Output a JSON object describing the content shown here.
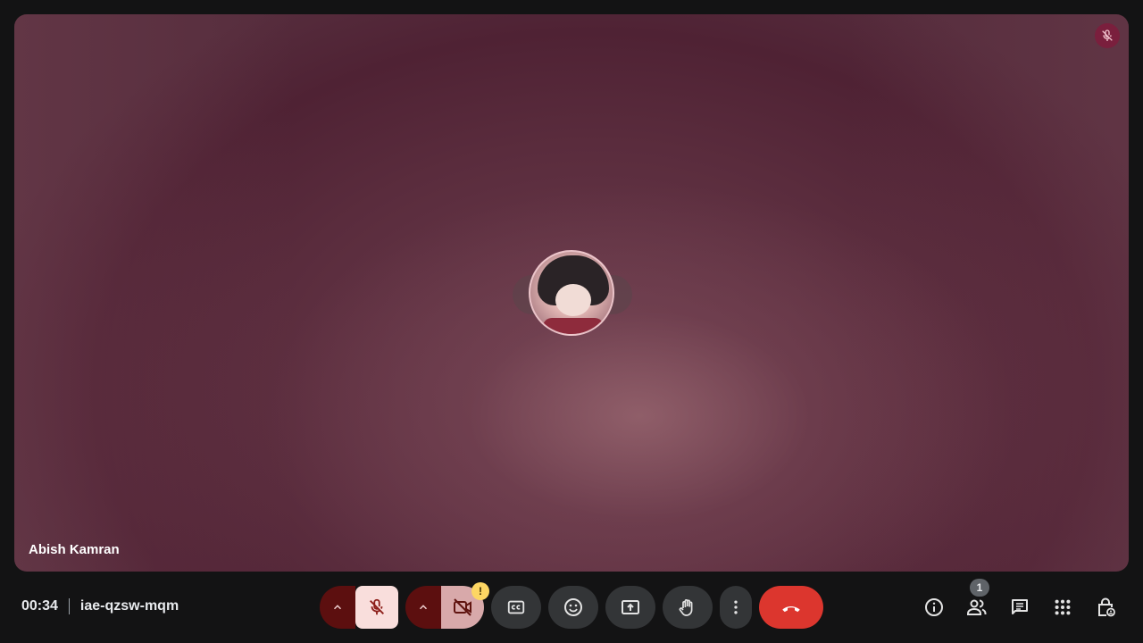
{
  "participant": {
    "name": "Abish Kamran",
    "avatar_icon": "user-avatar"
  },
  "meeting": {
    "time": "00:34",
    "code": "iae-qzsw-mqm"
  },
  "controls": {
    "mic": {
      "state": "muted",
      "icon": "mic-off-icon"
    },
    "camera": {
      "state": "off",
      "icon": "videocam-off-icon",
      "warning": "!"
    },
    "captions_icon": "closed-captions-icon",
    "reactions_icon": "emoji-icon",
    "present_icon": "present-screen-icon",
    "raise_hand_icon": "hand-icon",
    "more_icon": "more-vert-icon",
    "hangup_icon": "call-end-icon"
  },
  "right_panel": {
    "info_icon": "info-icon",
    "people_icon": "people-icon",
    "people_count": "1",
    "chat_icon": "chat-icon",
    "activities_icon": "apps-grid-icon",
    "host_controls_icon": "lock-person-icon"
  },
  "colors": {
    "background": "#131314",
    "hangup": "#dc362e",
    "mic_muted_bg": "#f9dedc",
    "split_dark": "#5c0f0f",
    "control_bg": "#333537",
    "warning": "#fdd663"
  }
}
